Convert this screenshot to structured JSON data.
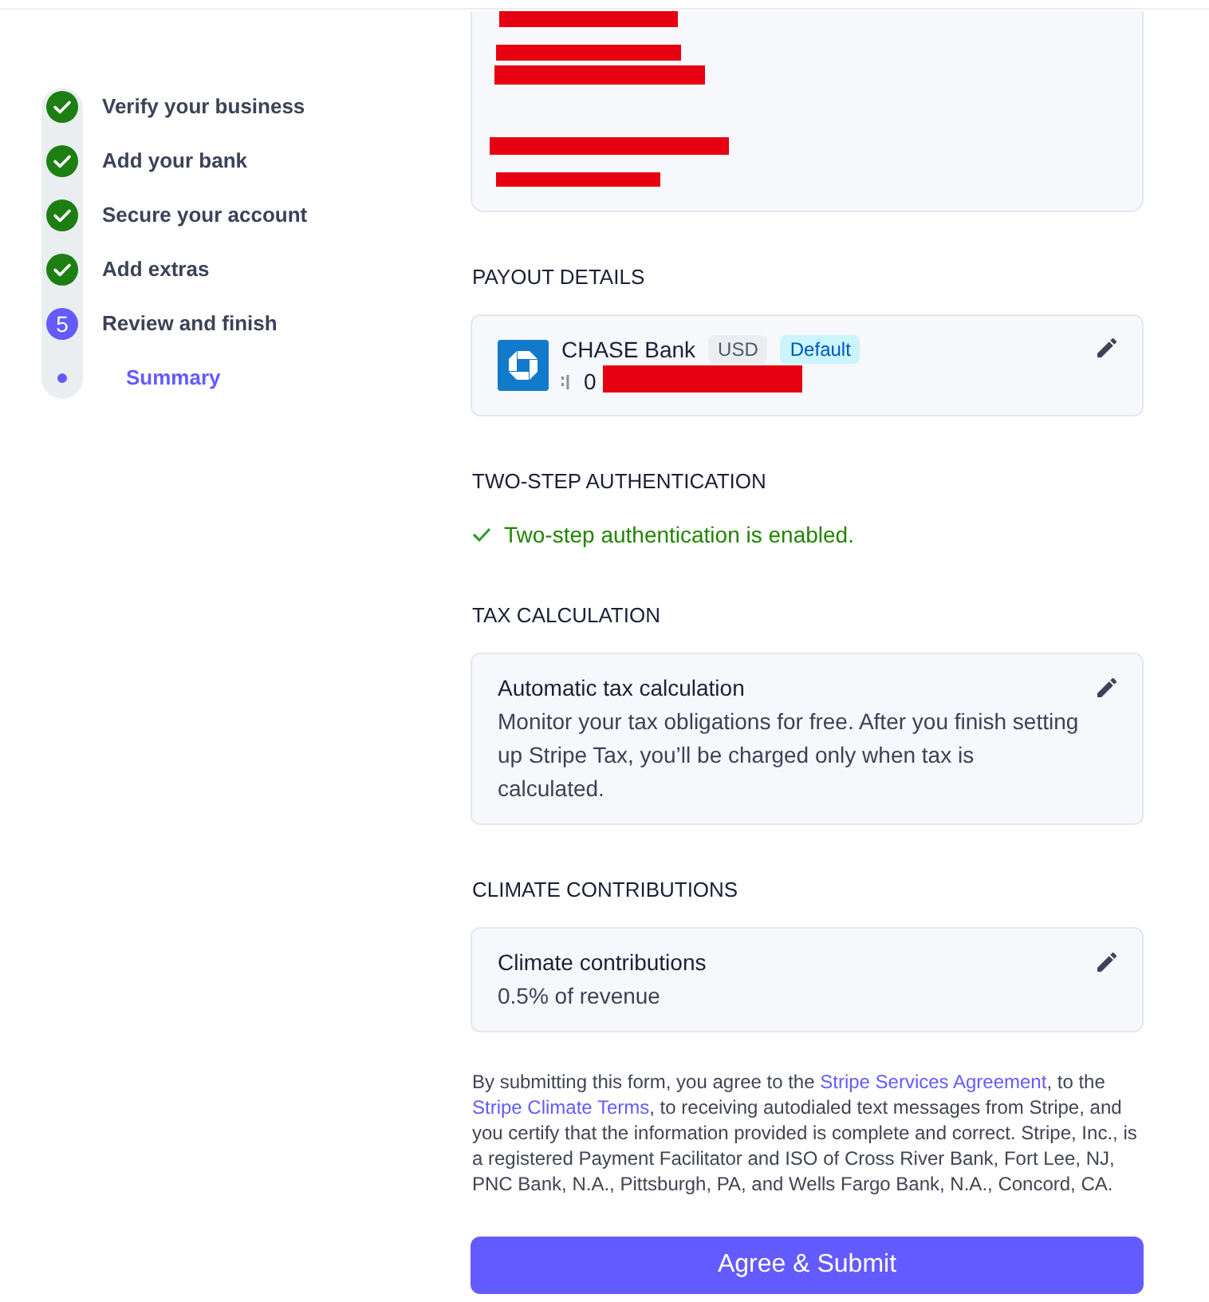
{
  "steps": [
    {
      "label": "Verify your business",
      "completed": true
    },
    {
      "label": "Add your bank",
      "completed": true
    },
    {
      "label": "Secure your account",
      "completed": true
    },
    {
      "label": "Add extras",
      "completed": true
    },
    {
      "label": "Review and finish",
      "completed": false,
      "number": "5",
      "children": [
        {
          "label": "Summary",
          "selected": true
        }
      ]
    }
  ],
  "summary_card": {
    "lines": [
      {
        "redacted": true
      },
      {
        "redacted": true
      },
      {
        "redacted": true
      },
      {
        "redacted": true
      },
      {
        "redacted": true
      }
    ]
  },
  "payout": {
    "heading": "PAYOUT DETAILS",
    "bank_name": "CHASE Bank",
    "badges": [
      {
        "label": "USD",
        "kind": "currency"
      },
      {
        "label": "Default",
        "kind": "default"
      }
    ],
    "account_number": "0",
    "account_redacted": true
  },
  "two_step": {
    "heading": "TWO-STEP AUTHENTICATION",
    "status": "Two-step authentication is enabled.",
    "enabled": true
  },
  "tax": {
    "heading": "TAX CALCULATION",
    "title": "Automatic tax calculation",
    "description": "Monitor your tax obligations for free. After you finish setting up Stripe Tax, you’ll be charged only when tax is calculated."
  },
  "climate": {
    "heading": "CLIMATE CONTRIBUTIONS",
    "title": "Climate contributions",
    "value": "0.5% of revenue"
  },
  "legal": [
    {
      "kind": "text",
      "text": "By submitting this form, you agree to the "
    },
    {
      "kind": "link",
      "text": "Stripe Services Agreement"
    },
    {
      "kind": "text",
      "text": ", to the "
    },
    {
      "kind": "link",
      "text": "Stripe Climate Terms"
    },
    {
      "kind": "text",
      "text": ", to receiving autodialed text messages from Stripe, and you certify that the information provided is complete and correct. Stripe, Inc., is a registered Payment Facilitator and ISO of Cross River Bank, Fort Lee, NJ, PNC Bank, N.A., Pittsburgh, PA, and Wells Fargo Bank, N.A., Concord, CA."
    }
  ],
  "submit_button": "Agree & Submit"
}
